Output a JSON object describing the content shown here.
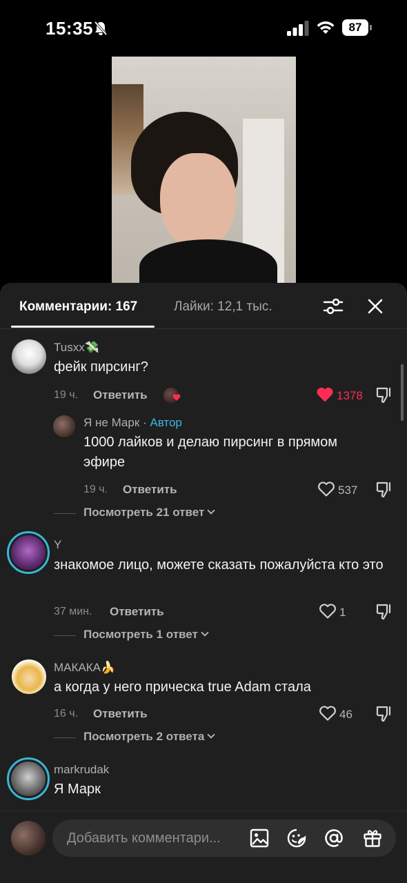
{
  "status_bar": {
    "time": "15:35",
    "battery": "87",
    "icons": [
      "bell-off-icon",
      "signal-icon",
      "wifi-icon",
      "battery-icon"
    ]
  },
  "tabs": {
    "comments_label": "Комментарии: 167",
    "likes_label": "Лайки: 12,1 тыс.",
    "active": "comments"
  },
  "comments": [
    {
      "username": "Tusxx💸",
      "text": "фейк пирсинг?",
      "time": "19 ч.",
      "reply_label": "Ответить",
      "likes": "1378",
      "liked": true,
      "reply": {
        "username": "Я не Марк",
        "separator": " · ",
        "author_tag": "Автор",
        "text": "1000 лайков и делаю пирсинг в прямом эфире",
        "time": "19 ч.",
        "reply_label": "Ответить",
        "likes": "537"
      },
      "view_replies": "Посмотреть 21 ответ"
    },
    {
      "username": "Y",
      "text": "знакомое лицо, можете сказать пожалуйста кто это",
      "time": "37 мин.",
      "reply_label": "Ответить",
      "likes": "1",
      "view_replies": "Посмотреть 1 ответ"
    },
    {
      "username": "МАКАКА🍌",
      "text": "а когда у него прическа true Adam стала",
      "time": "16 ч.",
      "reply_label": "Ответить",
      "likes": "46",
      "view_replies": "Посмотреть 2 ответа"
    },
    {
      "username": "markrudak",
      "text": "Я Марк"
    }
  ],
  "input": {
    "placeholder": "Добавить комментари..."
  },
  "colors": {
    "panel_bg": "#1f1f1f",
    "like_red": "#fe2c55",
    "author_blue": "#3ab7e6",
    "story_ring": "#37b8d8"
  }
}
